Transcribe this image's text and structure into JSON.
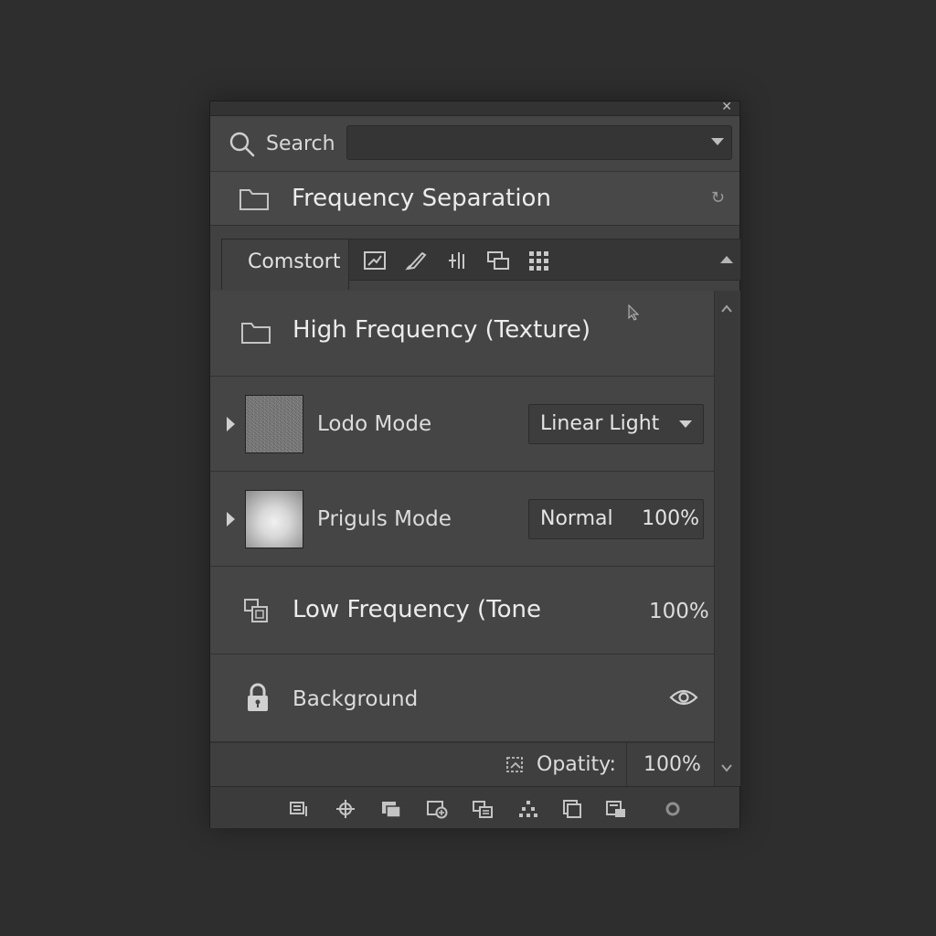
{
  "panel": {
    "close_icon": "close-icon"
  },
  "search": {
    "label": "Search",
    "value": ""
  },
  "group": {
    "title": "Frequency Separation"
  },
  "tabs": {
    "active_label": "Comstort",
    "tool_icons": [
      "adjust-icon",
      "brush-icon",
      "levels-icon",
      "stack-icon",
      "grid-icon"
    ]
  },
  "layers": {
    "high_frequency": {
      "title": "High Frequency (Texture)"
    },
    "lodo": {
      "label": "Lodo Mode",
      "blend_mode": "Linear Light"
    },
    "priguls": {
      "label": "Priguls Mode",
      "blend_mode": "Normal",
      "opacity": "100%"
    },
    "low_frequency": {
      "title": "Low Frequency (Tone",
      "opacity": "100%"
    },
    "background": {
      "title": "Background"
    }
  },
  "opacity": {
    "label": "Opatity:",
    "value": "100%"
  },
  "bottom_icons": [
    "link-icon",
    "move-icon",
    "fill-icon",
    "add-mask-icon",
    "group-icon",
    "filter-icon",
    "duplicate-icon",
    "new-layer-icon",
    "settings-icon"
  ]
}
